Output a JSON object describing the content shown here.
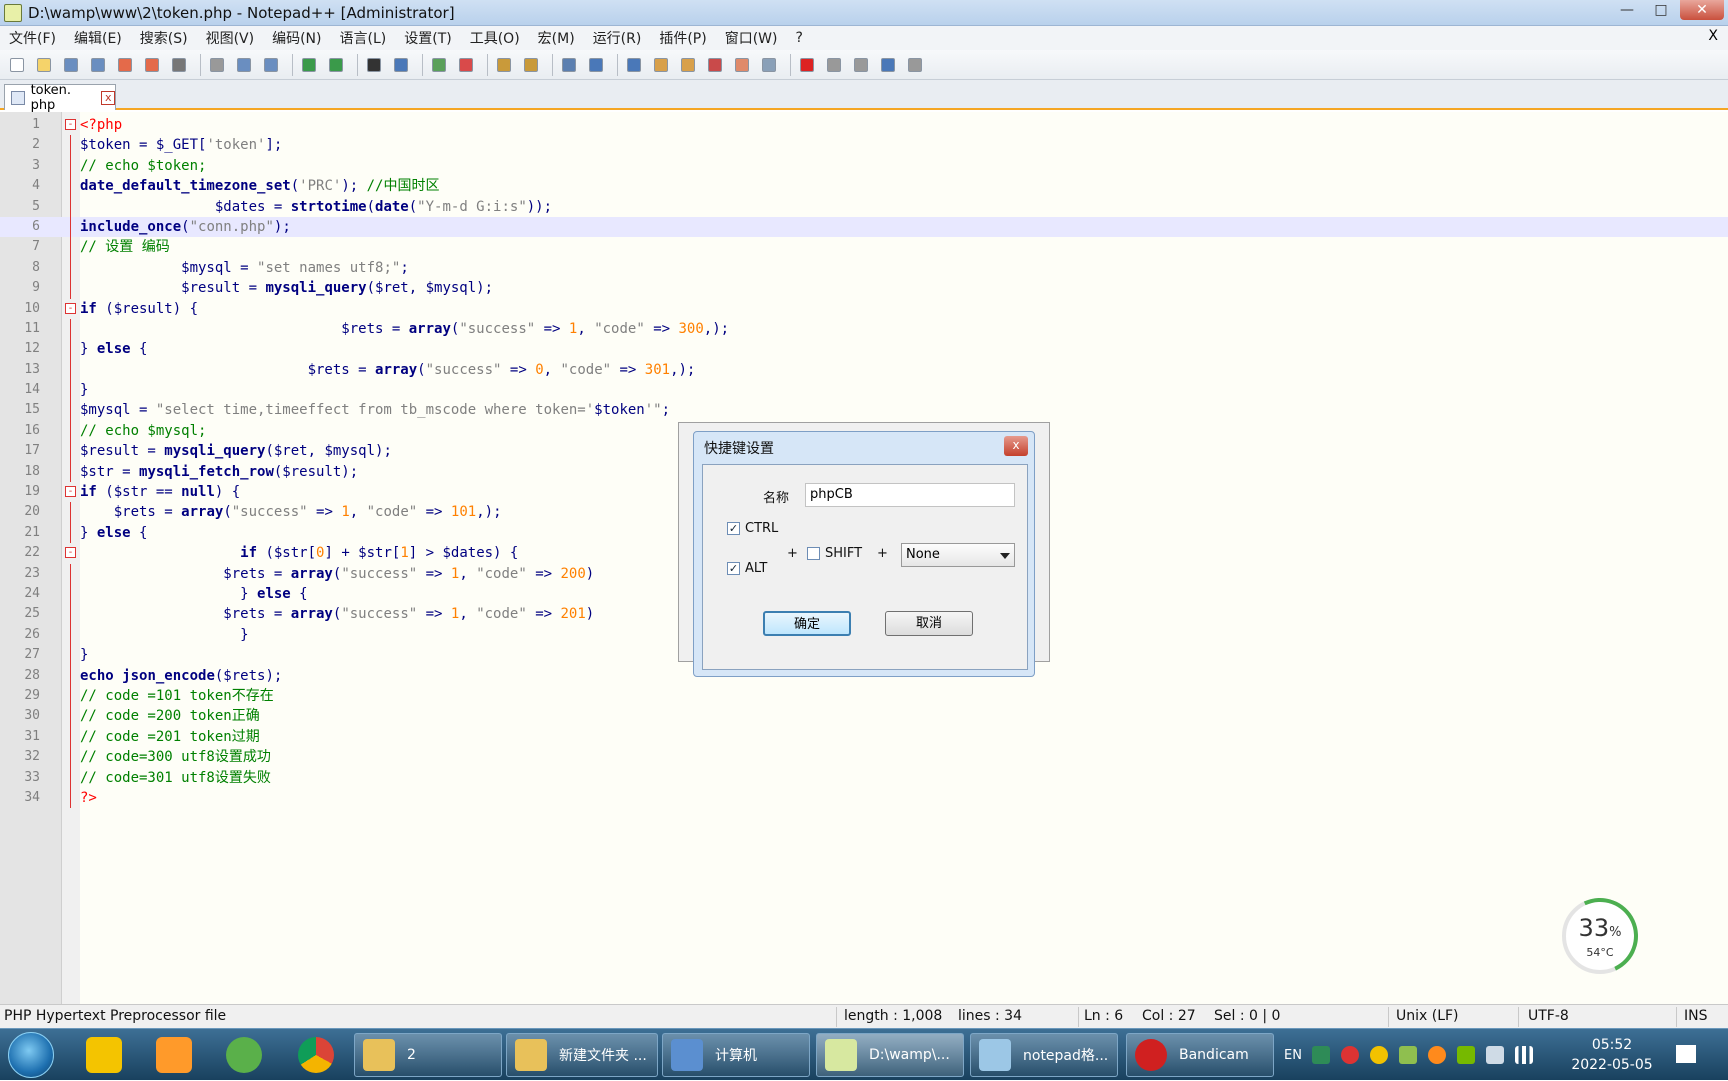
{
  "window": {
    "title": "D:\\wamp\\www\\2\\token.php - Notepad++ [Administrator]",
    "min": "—",
    "max": "□",
    "close": "✕"
  },
  "menu": [
    "文件(F)",
    "编辑(E)",
    "搜索(S)",
    "视图(V)",
    "编码(N)",
    "语言(L)",
    "设置(T)",
    "工具(O)",
    "宏(M)",
    "运行(R)",
    "插件(P)",
    "窗口(W)",
    "?"
  ],
  "menu_close": "X",
  "tab": {
    "label": "token. php",
    "close": "x"
  },
  "editor": {
    "current_line": 6
  },
  "lines": [
    {
      "n": "1",
      "fold": "-",
      "tokens": [
        [
          "tg",
          "<?php"
        ]
      ]
    },
    {
      "n": "2",
      "tokens": [
        [
          "vr",
          "$token = $_GET["
        ],
        [
          "st",
          "'token'"
        ],
        [
          "vr",
          "];"
        ]
      ]
    },
    {
      "n": "3",
      "tokens": [
        [
          "cm",
          "// echo $token;"
        ]
      ]
    },
    {
      "n": "4",
      "tokens": [
        [
          "fn",
          "date_default_timezone_set"
        ],
        [
          "vr",
          "("
        ],
        [
          "st",
          "'PRC'"
        ],
        [
          "vr",
          "); "
        ],
        [
          "cm",
          "//中国时区"
        ]
      ]
    },
    {
      "n": "5",
      "tokens": [
        [
          "vr",
          "                $dates = "
        ],
        [
          "fn",
          "strtotime"
        ],
        [
          "vr",
          "("
        ],
        [
          "fn",
          "date"
        ],
        [
          "vr",
          "("
        ],
        [
          "st",
          "\"Y-m-d G:i:s\""
        ],
        [
          "vr",
          "));"
        ]
      ]
    },
    {
      "n": "6",
      "tokens": [
        [
          "kw",
          "include_once"
        ],
        [
          "vr",
          "("
        ],
        [
          "st",
          "\"conn.php\""
        ],
        [
          "vr",
          ");"
        ]
      ]
    },
    {
      "n": "7",
      "tokens": [
        [
          "cm",
          "// 设置 编码"
        ]
      ]
    },
    {
      "n": "8",
      "tokens": [
        [
          "vr",
          "            $mysql = "
        ],
        [
          "st",
          "\"set names utf8;\""
        ],
        [
          "vr",
          ";"
        ]
      ]
    },
    {
      "n": "9",
      "tokens": [
        [
          "vr",
          "            $result = "
        ],
        [
          "fn",
          "mysqli_query"
        ],
        [
          "vr",
          "($ret, $mysql);"
        ]
      ]
    },
    {
      "n": "10",
      "fold": "-",
      "tokens": [
        [
          "kw",
          "if"
        ],
        [
          "vr",
          " ($result) {"
        ]
      ]
    },
    {
      "n": "11",
      "tokens": [
        [
          "vr",
          "                               $rets = "
        ],
        [
          "kw",
          "array"
        ],
        [
          "vr",
          "("
        ],
        [
          "st",
          "\"success\""
        ],
        [
          "vr",
          " => "
        ],
        [
          "nm",
          "1"
        ],
        [
          "vr",
          ", "
        ],
        [
          "st",
          "\"code\""
        ],
        [
          "vr",
          " => "
        ],
        [
          "nm",
          "300"
        ],
        [
          "vr",
          ",);"
        ]
      ]
    },
    {
      "n": "12",
      "tokens": [
        [
          "vr",
          "} "
        ],
        [
          "kw",
          "else"
        ],
        [
          "vr",
          " {"
        ]
      ]
    },
    {
      "n": "13",
      "tokens": [
        [
          "vr",
          "                           $rets = "
        ],
        [
          "kw",
          "array"
        ],
        [
          "vr",
          "("
        ],
        [
          "st",
          "\"success\""
        ],
        [
          "vr",
          " => "
        ],
        [
          "nm",
          "0"
        ],
        [
          "vr",
          ", "
        ],
        [
          "st",
          "\"code\""
        ],
        [
          "vr",
          " => "
        ],
        [
          "nm",
          "301"
        ],
        [
          "vr",
          ",);"
        ]
      ]
    },
    {
      "n": "14",
      "tokens": [
        [
          "vr",
          "}"
        ]
      ]
    },
    {
      "n": "15",
      "tokens": [
        [
          "vr",
          "$mysql = "
        ],
        [
          "st",
          "\"select time,timeeffect from tb_mscode where token='"
        ],
        [
          "vr",
          "$token"
        ],
        [
          "st",
          "'\""
        ],
        [
          "vr",
          ";"
        ]
      ]
    },
    {
      "n": "16",
      "tokens": [
        [
          "cm",
          "// echo $mysql;"
        ]
      ]
    },
    {
      "n": "17",
      "tokens": [
        [
          "vr",
          "$result = "
        ],
        [
          "fn",
          "mysqli_query"
        ],
        [
          "vr",
          "($ret, $mysql);"
        ]
      ]
    },
    {
      "n": "18",
      "tokens": [
        [
          "vr",
          "$str = "
        ],
        [
          "fn",
          "mysqli_fetch_row"
        ],
        [
          "vr",
          "($result);"
        ]
      ]
    },
    {
      "n": "19",
      "fold": "-",
      "tokens": [
        [
          "kw",
          "if"
        ],
        [
          "vr",
          " ($str == "
        ],
        [
          "kw",
          "null"
        ],
        [
          "vr",
          ") {"
        ]
      ]
    },
    {
      "n": "20",
      "tokens": [
        [
          "vr",
          "    $rets = "
        ],
        [
          "kw",
          "array"
        ],
        [
          "vr",
          "("
        ],
        [
          "st",
          "\"success\""
        ],
        [
          "vr",
          " => "
        ],
        [
          "nm",
          "1"
        ],
        [
          "vr",
          ", "
        ],
        [
          "st",
          "\"code\""
        ],
        [
          "vr",
          " => "
        ],
        [
          "nm",
          "101"
        ],
        [
          "vr",
          ",);"
        ]
      ]
    },
    {
      "n": "21",
      "tokens": [
        [
          "vr",
          "} "
        ],
        [
          "kw",
          "else"
        ],
        [
          "vr",
          " {"
        ]
      ]
    },
    {
      "n": "22",
      "fold": "-",
      "tokens": [
        [
          "vr",
          "                   "
        ],
        [
          "kw",
          "if"
        ],
        [
          "vr",
          " ($str["
        ],
        [
          "nm",
          "0"
        ],
        [
          "vr",
          "] + $str["
        ],
        [
          "nm",
          "1"
        ],
        [
          "vr",
          "] > $dates) {"
        ]
      ]
    },
    {
      "n": "23",
      "tokens": [
        [
          "vr",
          "                 $rets = "
        ],
        [
          "kw",
          "array"
        ],
        [
          "vr",
          "("
        ],
        [
          "st",
          "\"success\""
        ],
        [
          "vr",
          " => "
        ],
        [
          "nm",
          "1"
        ],
        [
          "vr",
          ", "
        ],
        [
          "st",
          "\"code\""
        ],
        [
          "vr",
          " => "
        ],
        [
          "nm",
          "200"
        ],
        [
          "vr",
          ")"
        ]
      ]
    },
    {
      "n": "24",
      "tokens": [
        [
          "vr",
          "                   } "
        ],
        [
          "kw",
          "else"
        ],
        [
          "vr",
          " {"
        ]
      ]
    },
    {
      "n": "25",
      "tokens": [
        [
          "vr",
          "                 $rets = "
        ],
        [
          "kw",
          "array"
        ],
        [
          "vr",
          "("
        ],
        [
          "st",
          "\"success\""
        ],
        [
          "vr",
          " => "
        ],
        [
          "nm",
          "1"
        ],
        [
          "vr",
          ", "
        ],
        [
          "st",
          "\"code\""
        ],
        [
          "vr",
          " => "
        ],
        [
          "nm",
          "201"
        ],
        [
          "vr",
          ")"
        ]
      ]
    },
    {
      "n": "26",
      "tokens": [
        [
          "vr",
          "                   }"
        ]
      ]
    },
    {
      "n": "27",
      "tokens": [
        [
          "vr",
          "}"
        ]
      ]
    },
    {
      "n": "28",
      "tokens": [
        [
          "kw",
          "echo"
        ],
        [
          "vr",
          " "
        ],
        [
          "fn",
          "json_encode"
        ],
        [
          "vr",
          "($rets);"
        ]
      ]
    },
    {
      "n": "29",
      "tokens": [
        [
          "cm",
          "// code =101 token不存在"
        ]
      ]
    },
    {
      "n": "30",
      "tokens": [
        [
          "cm",
          "// code =200 token正确"
        ]
      ]
    },
    {
      "n": "31",
      "tokens": [
        [
          "cm",
          "// code =201 token过期"
        ]
      ]
    },
    {
      "n": "32",
      "tokens": [
        [
          "cm",
          "// code=300 utf8设置成功"
        ]
      ]
    },
    {
      "n": "33",
      "tokens": [
        [
          "cm",
          "// code=301 utf8设置失败"
        ]
      ]
    },
    {
      "n": "34",
      "tokens": [
        [
          "tg",
          "?>"
        ]
      ]
    }
  ],
  "dialog": {
    "title": "快捷键设置",
    "close": "x",
    "name_label": "名称",
    "name_value": "phpCB",
    "ctrl_label": "CTRL",
    "alt_label": "ALT",
    "shift_label": "SHIFT",
    "ctrl_checked": true,
    "alt_checked": true,
    "shift_checked": false,
    "plus": "+",
    "key_value": "None",
    "ok_label": "确定",
    "cancel_label": "取消"
  },
  "status": {
    "filetype": "PHP Hypertext Preprocessor file",
    "length": "length : 1,008",
    "lines": "lines : 34",
    "ln": "Ln : 6",
    "col": "Col : 27",
    "sel": "Sel : 0 | 0",
    "eol": "Unix (LF)",
    "encoding": "UTF-8",
    "mode": "INS"
  },
  "widget": {
    "percent": "33",
    "percent_sign": "%",
    "temp": "54°C"
  },
  "taskbar": {
    "items": [
      {
        "label": "2",
        "color": "#e8c15a"
      },
      {
        "label": "新建文件夹 ...",
        "color": "#e8c15a"
      },
      {
        "label": "计算机",
        "color": "#5b8fd0"
      },
      {
        "label": "D:\\wamp\\...",
        "color": "#d7e8a0"
      },
      {
        "label": "notepad格...",
        "color": "#9cc7e6"
      },
      {
        "label": "Bandicam",
        "color": "#d02020"
      }
    ],
    "lang": "EN",
    "time": "05:52",
    "date": "2022-05-05"
  },
  "colors": {
    "fold_marker": "#dd3333",
    "current_line": "#e8e8ff",
    "accent_tab": "#f5a623"
  }
}
